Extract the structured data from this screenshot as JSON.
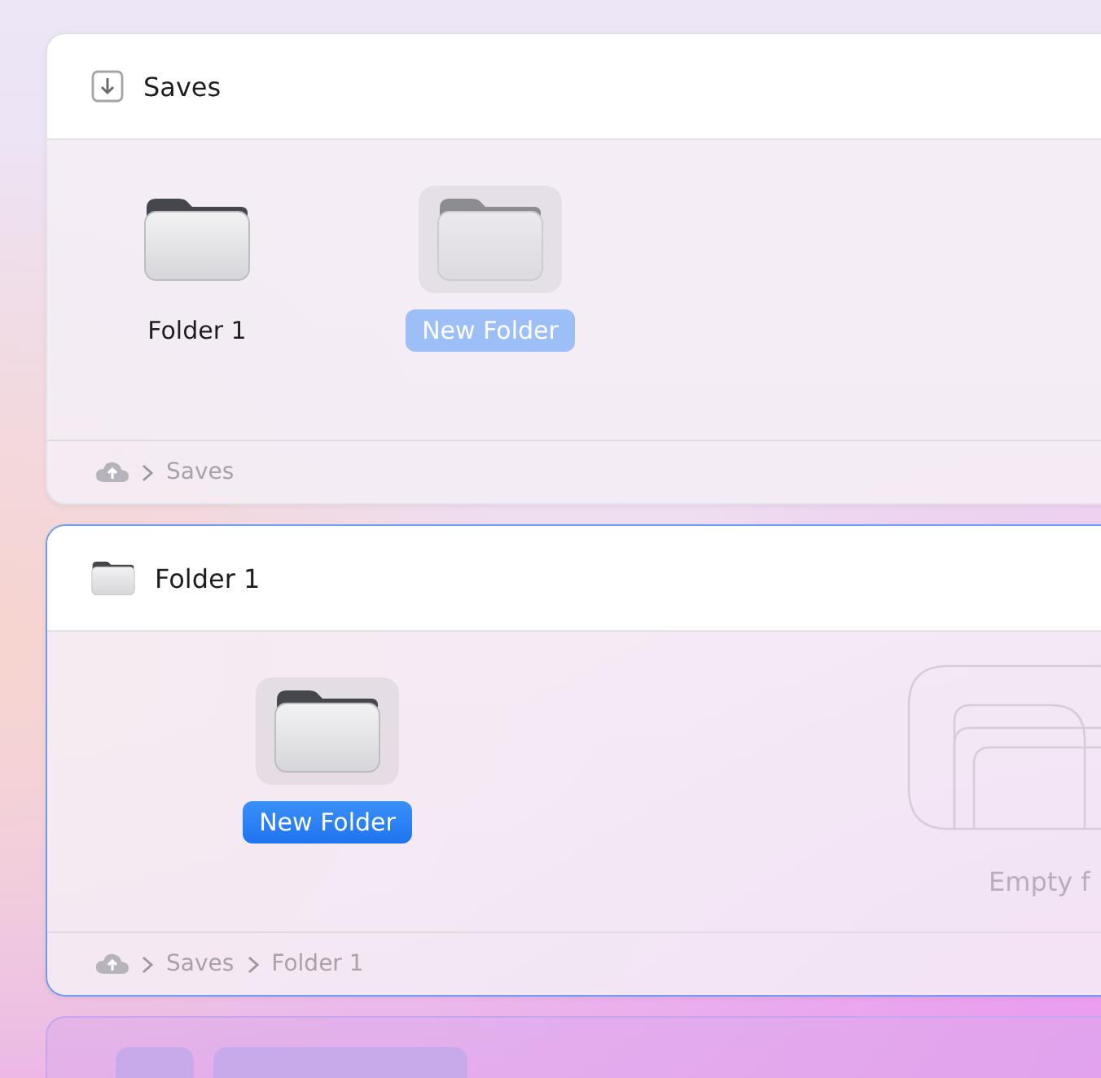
{
  "windows": [
    {
      "kind": "browser",
      "title": "Saves",
      "header_icon": {
        "kind": "download"
      },
      "focused": false,
      "items": [
        {
          "name": "Folder 1",
          "selected": false,
          "dimmed": false
        },
        {
          "name": "New Folder",
          "selected": true,
          "dimmed": true
        }
      ],
      "breadcrumb": [
        "Saves"
      ]
    },
    {
      "kind": "browser",
      "title": "Folder 1",
      "header_icon": {
        "kind": "folder"
      },
      "focused": true,
      "items": [
        {
          "name": "New Folder",
          "selected": true,
          "dimmed": false
        }
      ],
      "empty_label": "Empty f",
      "breadcrumb": [
        "Saves",
        "Folder 1"
      ]
    },
    {
      "kind": "skeleton"
    }
  ]
}
